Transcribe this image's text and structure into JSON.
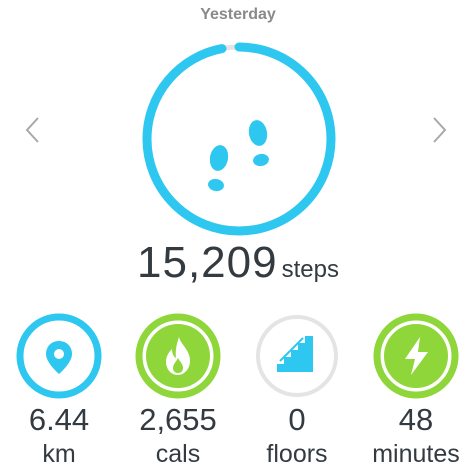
{
  "header": {
    "title": "Yesterday"
  },
  "nav": {
    "prev_icon": "chevron-left-icon",
    "next_icon": "chevron-right-icon"
  },
  "steps": {
    "value": "15,209",
    "unit": "steps",
    "icon": "footprints-icon",
    "progress": 0.97,
    "color": "#2ec7f0"
  },
  "stats": [
    {
      "id": "distance",
      "value": "6.44",
      "unit": "km",
      "icon": "location-pin-icon",
      "progress": 1.0,
      "color": "#2ec7f0",
      "goal_met": false
    },
    {
      "id": "calories",
      "value": "2,655",
      "unit": "cals",
      "icon": "flame-icon",
      "progress": 1.0,
      "color": "#8ed63a",
      "goal_met": true
    },
    {
      "id": "floors",
      "value": "0",
      "unit": "floors",
      "icon": "stairs-icon",
      "progress": 0.0,
      "color": "#2ec7f0",
      "goal_met": false
    },
    {
      "id": "active",
      "value": "48",
      "unit": "minutes",
      "icon": "lightning-icon",
      "progress": 1.0,
      "color": "#8ed63a",
      "goal_met": true
    }
  ],
  "colors": {
    "track": "#e4e4e4",
    "text": "#333a40",
    "title": "#8a8a8a",
    "arrow": "#a9a9a9"
  }
}
